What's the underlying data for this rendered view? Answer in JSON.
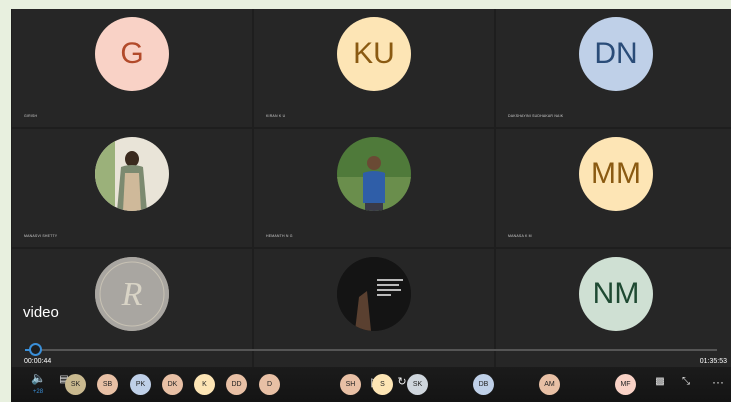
{
  "colors": {
    "peach": "#f9d2c6",
    "cream": "#fde5b5",
    "blue": "#bfd0e8",
    "accent": "#3a8fd8"
  },
  "tiles": [
    {
      "initials": "G",
      "name": "GIRISH",
      "bg": "#f9d2c6",
      "fg": "#b24a2a"
    },
    {
      "initials": "KU",
      "name": "KIRAN K U",
      "bg": "#fde5b5",
      "fg": "#8a5a12"
    },
    {
      "initials": "DN",
      "name": "DAKSHAYINI SUDHAKAR NAIK",
      "bg": "#bfd0e8",
      "fg": "#2a4c78"
    },
    {
      "initials": "",
      "name": "MANASVI SHETTY",
      "bg": "#2a2a2a",
      "fg": "#fff",
      "photo": "woman"
    },
    {
      "initials": "",
      "name": "HEMANTH N G",
      "bg": "#2a2a2a",
      "fg": "#fff",
      "photo": "man"
    },
    {
      "initials": "MM",
      "name": "MANASA K M",
      "bg": "#fde5b5",
      "fg": "#8a5a12"
    },
    {
      "initials": "",
      "name": "",
      "bg": "#9a9590",
      "fg": "#fff",
      "photo": "logo"
    },
    {
      "initials": "",
      "name": "",
      "bg": "#1a1a1a",
      "fg": "#fff",
      "photo": "quote"
    },
    {
      "initials": "NM",
      "name": "",
      "bg": "#cfe0d3",
      "fg": "#1f4a32"
    }
  ],
  "overlay": {
    "label": "video",
    "current_time": "00:00:44",
    "total_time": "01:35:53",
    "progress": 0.008
  },
  "controls": {
    "volume_icon": "volume-icon",
    "volume_badge": "+28"
  },
  "participants_strip": [
    "SK",
    "SB",
    "PK",
    "DK",
    "K",
    "DD",
    "D",
    "SH",
    "S",
    "SK",
    "DB",
    "AM",
    "MF"
  ],
  "chip_colors": [
    "#c9b98f",
    "#e8c0a5",
    "#bfd0e8",
    "#e8c0a5",
    "#fde5b5",
    "#e8c0a5",
    "#e8c0a5",
    "#e8c0a5",
    "#fde5b5",
    "#cfd6dd",
    "#bfd0e8",
    "#e8c0a5",
    "#f9d2c6"
  ]
}
